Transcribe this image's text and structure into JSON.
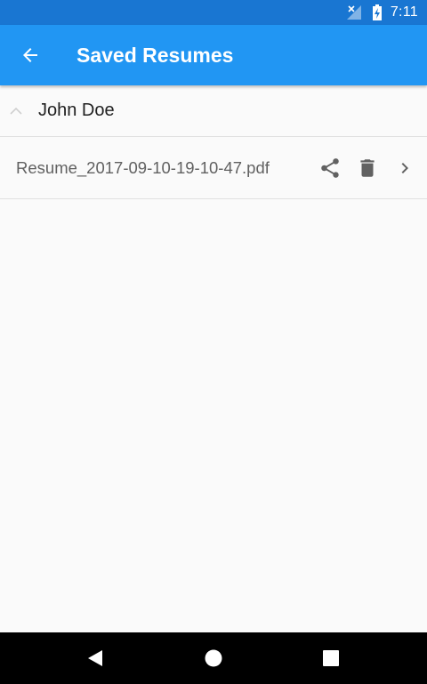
{
  "status_bar": {
    "time": "7:11",
    "icons": [
      "no-signal-icon",
      "battery-charging-icon"
    ]
  },
  "app_bar": {
    "title": "Saved Resumes",
    "back_icon": "arrow-back-icon"
  },
  "groups": [
    {
      "name": "John Doe",
      "expanded": true,
      "files": [
        {
          "name": "Resume_2017-09-10-19-10-47.pdf",
          "actions": [
            "share-icon",
            "delete-icon",
            "chevron-right-icon"
          ]
        }
      ]
    }
  ],
  "nav_bar": {
    "buttons": [
      "back-triangle-icon",
      "home-circle-icon",
      "recents-square-icon"
    ]
  },
  "colors": {
    "status_bar": "#1976d2",
    "app_bar": "#2196f3",
    "background": "#fafafa",
    "nav_bar": "#000000"
  }
}
